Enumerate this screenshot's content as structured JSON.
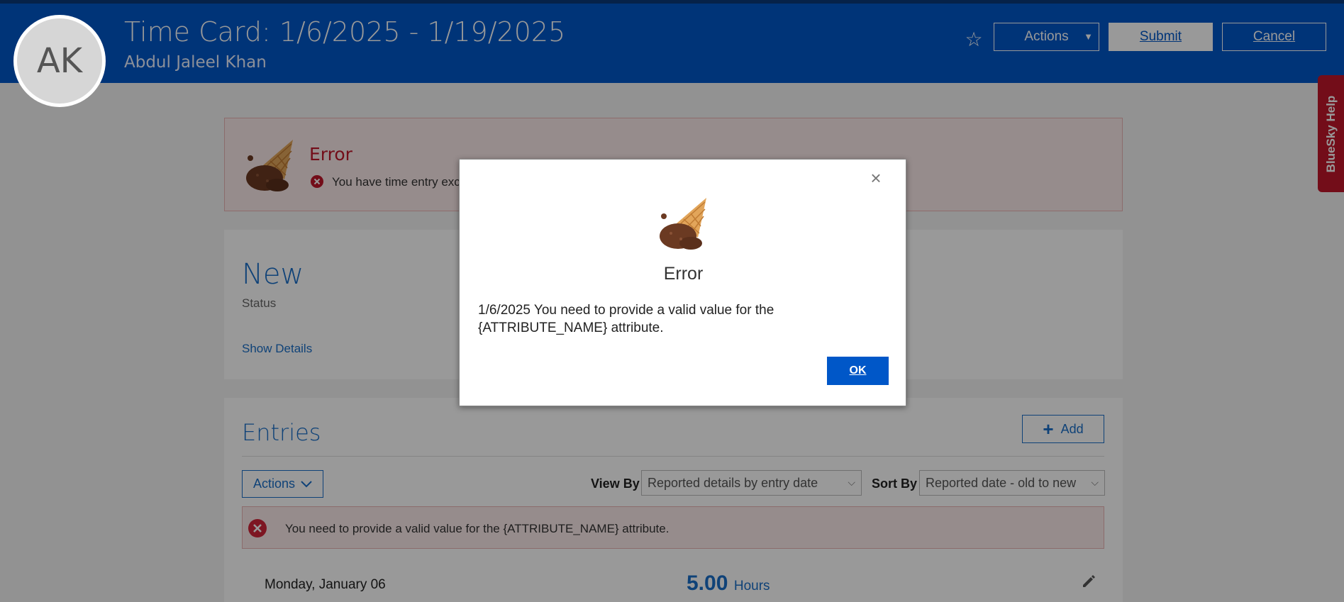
{
  "header": {
    "avatar_initials": "AK",
    "title": "Time Card: 1/6/2025 - 1/19/2025",
    "subtitle": "Abdul Jaleel Khan",
    "actions_label": "Actions",
    "submit_label": "Submit",
    "cancel_label": "Cancel"
  },
  "help_tab": {
    "label": "BlueSky Help"
  },
  "error_banner": {
    "title": "Error",
    "message": "You have time entry exc"
  },
  "status_card": {
    "status_value": "New",
    "status_label": "Status",
    "show_details": "Show Details"
  },
  "entries": {
    "title": "Entries",
    "add_label": "Add",
    "actions_label": "Actions",
    "view_by_label": "View By",
    "view_by_value": "Reported details by entry date",
    "sort_by_label": "Sort By",
    "sort_by_value": "Reported date - old to new",
    "validation_error": "You need to provide a valid value for the {ATTRIBUTE_NAME} attribute.",
    "rows": [
      {
        "date": "Monday, January 06",
        "hours": "5.00",
        "unit": "Hours"
      }
    ]
  },
  "dialog": {
    "title": "Error",
    "message": "1/6/2025 You need to provide a valid value for the {ATTRIBUTE_NAME} attribute.",
    "ok_label": "OK"
  },
  "colors": {
    "brand_blue": "#0057c8",
    "error_red": "#c0172a",
    "error_bg": "#fbeaea"
  }
}
